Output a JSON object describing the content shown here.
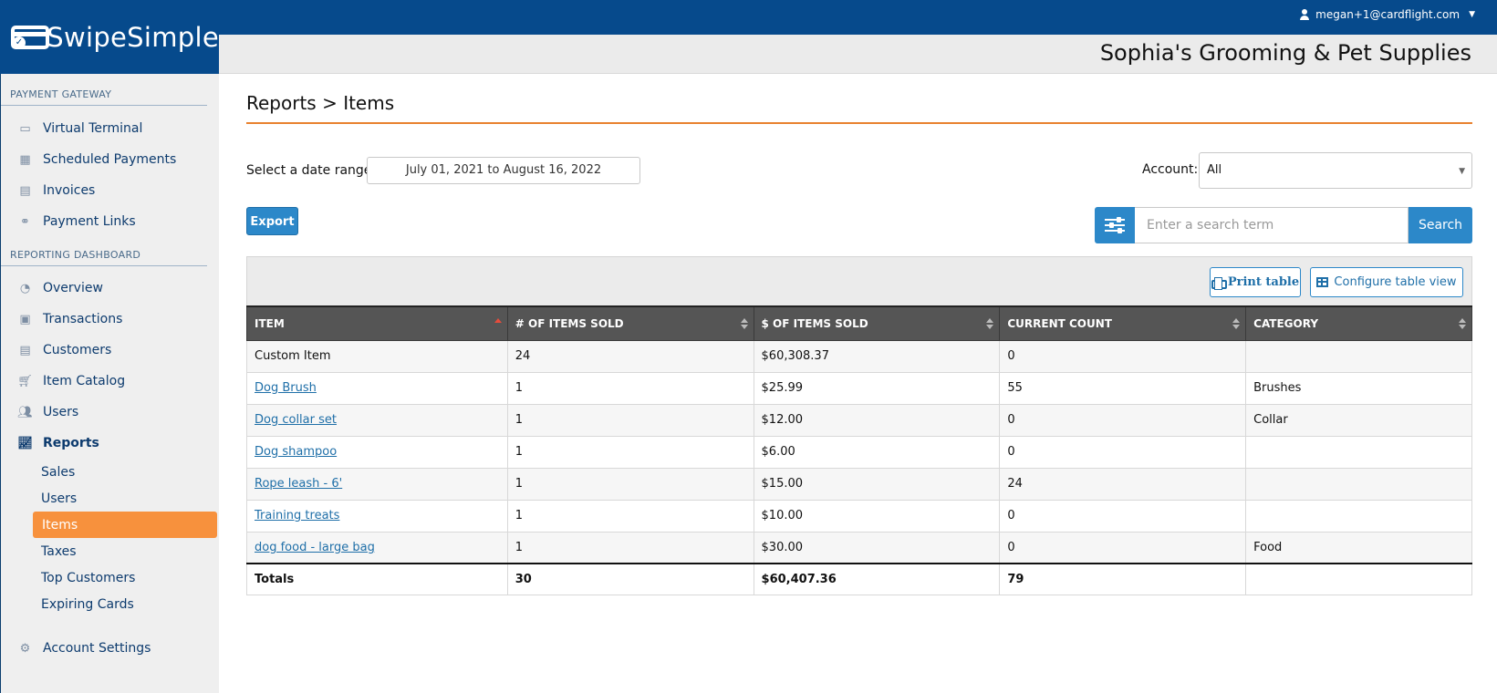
{
  "app": {
    "brand": "SwipeSimple",
    "user_email": "megan+1@cardflight.com",
    "merchant_name": "Sophia's Grooming & Pet Supplies"
  },
  "sidebar": {
    "payment_gateway_title": "PAYMENT GATEWAY",
    "payment_items": [
      {
        "label": "Virtual Terminal",
        "icon": "credit-card-icon"
      },
      {
        "label": "Scheduled Payments",
        "icon": "calendar-icon"
      },
      {
        "label": "Invoices",
        "icon": "invoice-icon"
      },
      {
        "label": "Payment Links",
        "icon": "link-icon"
      }
    ],
    "reporting_title": "REPORTING DASHBOARD",
    "reporting_items": [
      {
        "label": "Overview",
        "icon": "dashboard-icon"
      },
      {
        "label": "Transactions",
        "icon": "money-icon"
      },
      {
        "label": "Customers",
        "icon": "address-card-icon"
      },
      {
        "label": "Item Catalog",
        "icon": "cart-icon"
      },
      {
        "label": "Users",
        "icon": "users-icon"
      },
      {
        "label": "Reports",
        "icon": "chart-line-icon"
      }
    ],
    "report_subitems": [
      "Sales",
      "Users",
      "Items",
      "Taxes",
      "Top Customers",
      "Expiring Cards"
    ],
    "active_subitem": "Items",
    "account_settings": {
      "label": "Account Settings",
      "icon": "gear-icon"
    }
  },
  "page": {
    "breadcrumb": "Reports > Items",
    "date_range_label": "Select a date range:",
    "date_range_value": "July 01, 2021 to August 16, 2022",
    "account_label": "Account:",
    "account_value": "All",
    "export_label": "Export",
    "search_placeholder": "Enter a search term",
    "search_label": "Search",
    "print_label": "Print table",
    "configure_label": "Configure table view"
  },
  "table": {
    "columns": [
      "ITEM",
      "# OF ITEMS SOLD",
      "$ OF ITEMS SOLD",
      "CURRENT COUNT",
      "CATEGORY"
    ],
    "sorted_column": "ITEM",
    "rows": [
      {
        "item": "Custom Item",
        "link": false,
        "sold": "24",
        "amount": "$60,308.37",
        "count": "0",
        "category": ""
      },
      {
        "item": "Dog Brush",
        "link": true,
        "sold": "1",
        "amount": "$25.99",
        "count": "55",
        "category": "Brushes"
      },
      {
        "item": "Dog collar set",
        "link": true,
        "sold": "1",
        "amount": "$12.00",
        "count": "0",
        "category": "Collar"
      },
      {
        "item": "Dog shampoo",
        "link": true,
        "sold": "1",
        "amount": "$6.00",
        "count": "0",
        "category": ""
      },
      {
        "item": "Rope leash - 6'",
        "link": true,
        "sold": "1",
        "amount": "$15.00",
        "count": "24",
        "category": ""
      },
      {
        "item": "Training treats",
        "link": true,
        "sold": "1",
        "amount": "$10.00",
        "count": "0",
        "category": ""
      },
      {
        "item": "dog food - large bag",
        "link": true,
        "sold": "1",
        "amount": "$30.00",
        "count": "0",
        "category": "Food"
      }
    ],
    "totals": {
      "label": "Totals",
      "sold": "30",
      "amount": "$60,407.36",
      "count": "79",
      "category": ""
    }
  },
  "colors": {
    "brand_blue": "#064a8c",
    "accent_orange": "#f7913d",
    "button_blue": "#2c88c9",
    "table_header": "#555555"
  }
}
